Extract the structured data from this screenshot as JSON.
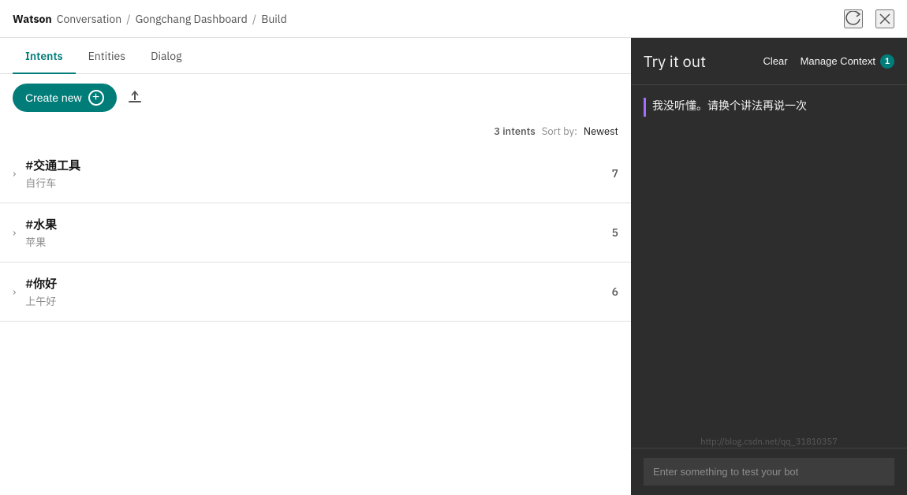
{
  "topnav": {
    "brand": "Watson",
    "app_name": "Conversation",
    "separator1": "/",
    "workspace": "Gongchang Dashboard",
    "separator2": "/",
    "page": "Build",
    "refresh_icon": "↺",
    "close_icon": "✕"
  },
  "tabs": [
    {
      "id": "intents",
      "label": "Intents",
      "active": true
    },
    {
      "id": "entities",
      "label": "Entities",
      "active": false
    },
    {
      "id": "dialog",
      "label": "Dialog",
      "active": false
    }
  ],
  "toolbar": {
    "create_new_label": "Create new",
    "upload_tooltip": "Upload"
  },
  "intent_list": {
    "count_text": "3 intents",
    "sort_label": "Sort by:",
    "sort_value": "Newest",
    "items": [
      {
        "name": "#交通工具",
        "sub": "自行车",
        "count": "7"
      },
      {
        "name": "#水果",
        "sub": "苹果",
        "count": "5"
      },
      {
        "name": "#你好",
        "sub": "上午好",
        "count": "6"
      }
    ]
  },
  "try_panel": {
    "title": "Try it out",
    "clear_label": "Clear",
    "manage_context_label": "Manage Context",
    "manage_context_badge": "1",
    "chat_message": "我没听懂。请换个讲法再说一次",
    "input_placeholder": "Enter something to test your bot",
    "watermark": "http://blog.csdn.net/qq_31810357"
  }
}
